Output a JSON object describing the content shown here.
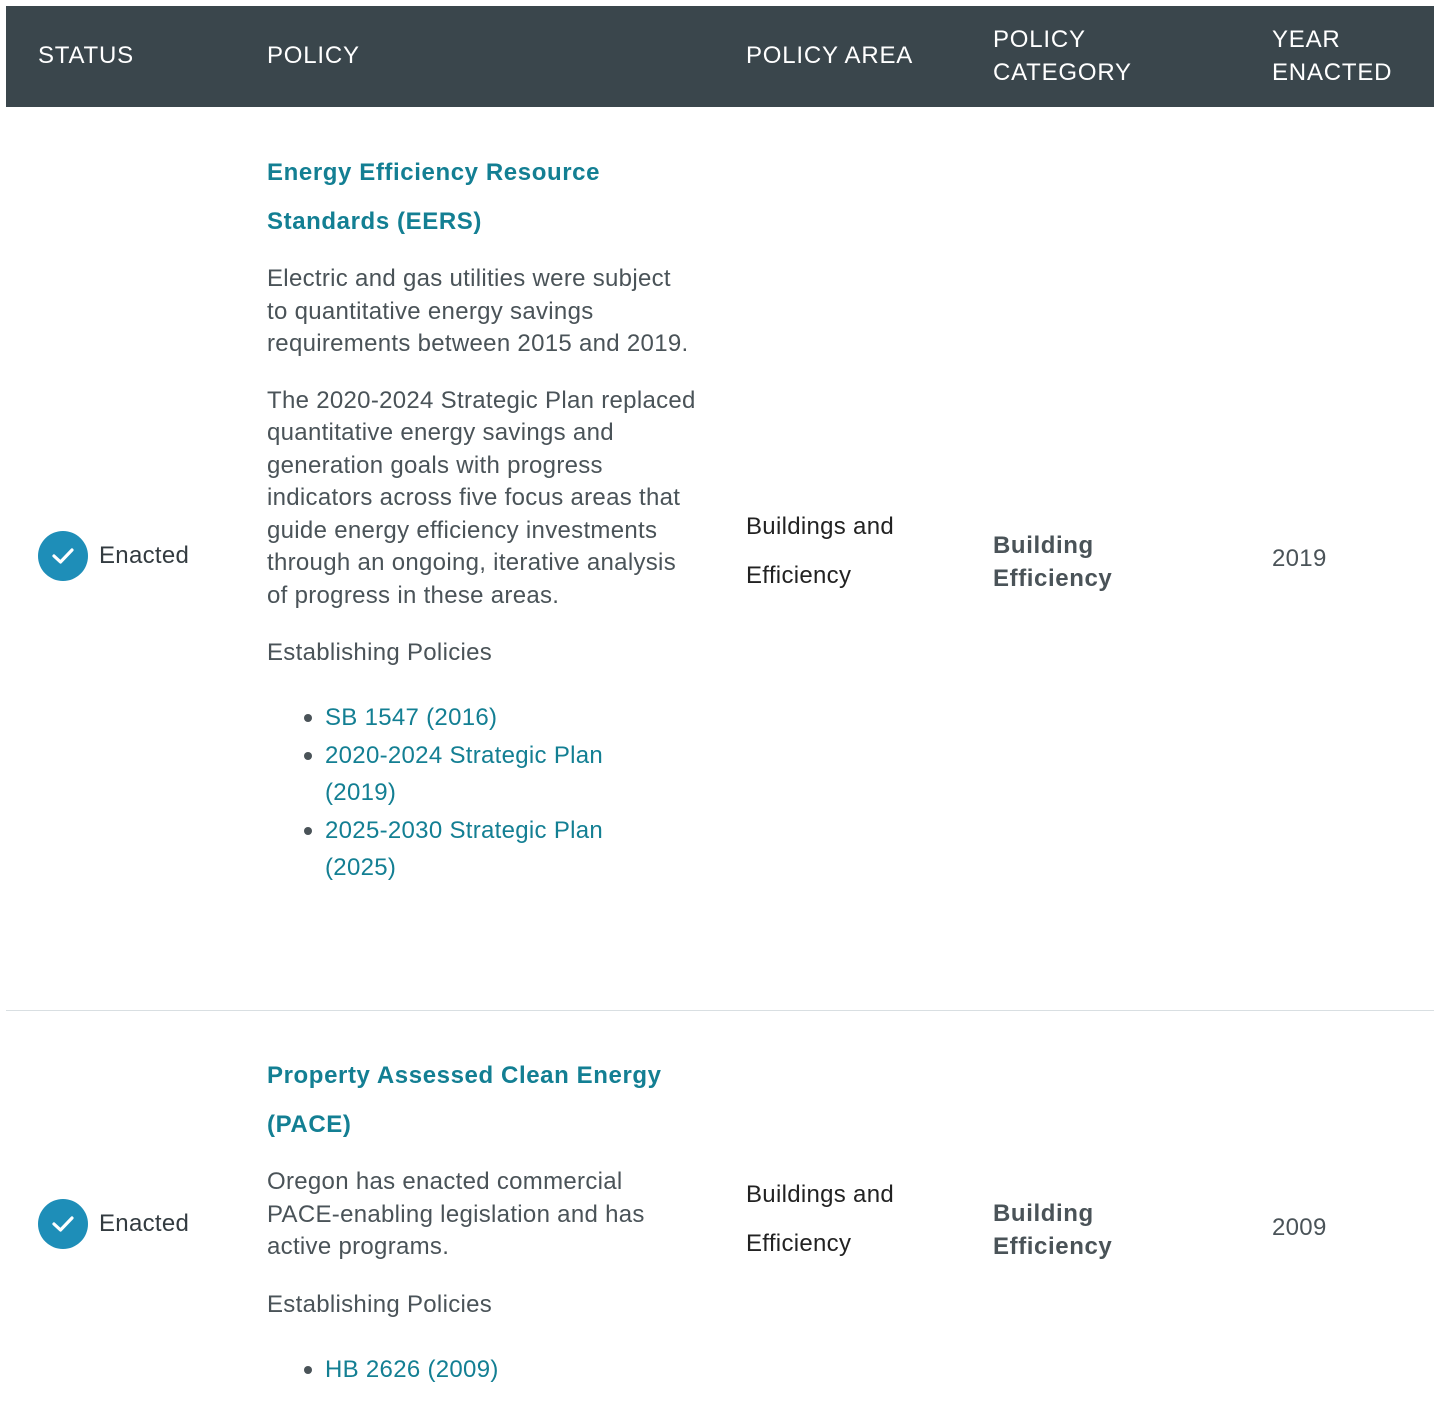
{
  "table": {
    "headers": {
      "status": "STATUS",
      "policy": "POLICY",
      "policy_area": "POLICY AREA",
      "policy_category": "POLICY CATEGORY",
      "year_enacted": "YEAR ENACTED"
    },
    "rows": [
      {
        "status": "Enacted",
        "status_icon": "check-circle-icon",
        "title": "Energy Efficiency Resource Standards (EERS)",
        "description": [
          "Electric and gas utilities were subject to quantitative energy savings requirements between 2015 and 2019.",
          "The 2020-2024 Strategic Plan replaced quantitative energy savings and generation goals with progress indicators across five focus areas that guide energy efficiency investments through an ongoing, iterative analysis of progress in these areas."
        ],
        "establishing_label": "Establishing Policies",
        "links": [
          "SB 1547 (2016)",
          "2020-2024 Strategic Plan (2019)",
          "2025-2030 Strategic Plan (2025)"
        ],
        "policy_area": "Buildings and Efficiency",
        "policy_category": "Building Efficiency",
        "year": "2019"
      },
      {
        "status": "Enacted",
        "status_icon": "check-circle-icon",
        "title": "Property Assessed Clean Energy (PACE)",
        "description": [
          "Oregon has enacted commercial PACE-enabling legislation and has active programs."
        ],
        "establishing_label": "Establishing Policies",
        "links": [
          "HB 2626 (2009)"
        ],
        "policy_area": "Buildings and Efficiency",
        "policy_category": "Building Efficiency",
        "year": "2009"
      }
    ]
  },
  "colors": {
    "header_bg": "#3a464c",
    "link": "#137f93",
    "check_bg": "#1e8eb8"
  }
}
